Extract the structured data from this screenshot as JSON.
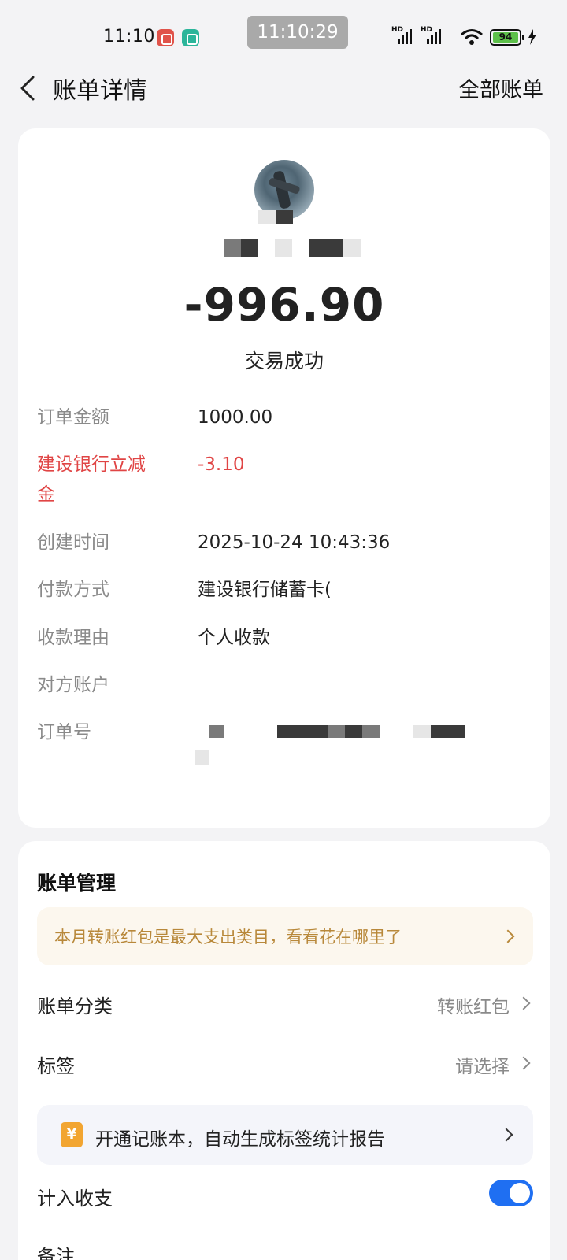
{
  "status_bar": {
    "time": "11:10",
    "clock_overlay": "11:10:29",
    "battery_level": "94",
    "signal_label": "HD",
    "icons": [
      "app-notification-icon",
      "app-notification-icon",
      "cellular-signal-icon",
      "cellular-signal-icon",
      "wifi-icon",
      "battery-icon",
      "charging-icon"
    ]
  },
  "header": {
    "title": "账单详情",
    "right_action": "全部账单",
    "back_icon": "chevron-left-icon"
  },
  "summary": {
    "amount": "-996.90",
    "status": "交易成功"
  },
  "details": [
    {
      "label": "订单金额",
      "value": "1000.00"
    },
    {
      "label": "建设银行立减金",
      "value": "-3.10"
    },
    {
      "label": "创建时间",
      "value": "2025-10-24 10:43:36"
    },
    {
      "label": "付款方式",
      "value": "建设银行储蓄卡("
    },
    {
      "label": "收款理由",
      "value": "个人收款"
    },
    {
      "label": "对方账户",
      "value": ""
    },
    {
      "label": "订单号",
      "value": ""
    }
  ],
  "manage": {
    "title": "账单管理",
    "insight": "本月转账红包是最大支出类目，看看花在哪里了",
    "category_label": "账单分类",
    "category_value": "转账红包",
    "tag_label": "标签",
    "tag_value": "请选择",
    "ledger_icon_glyph": "¥",
    "ledger_promo": "开通记账本，自动生成标签统计报告",
    "include_label": "计入收支",
    "include_enabled": true,
    "note_label": "备注"
  },
  "colors": {
    "discount_red": "#e04545",
    "toggle_blue": "#1f6ff2",
    "insight_gold": "#b8883a"
  }
}
